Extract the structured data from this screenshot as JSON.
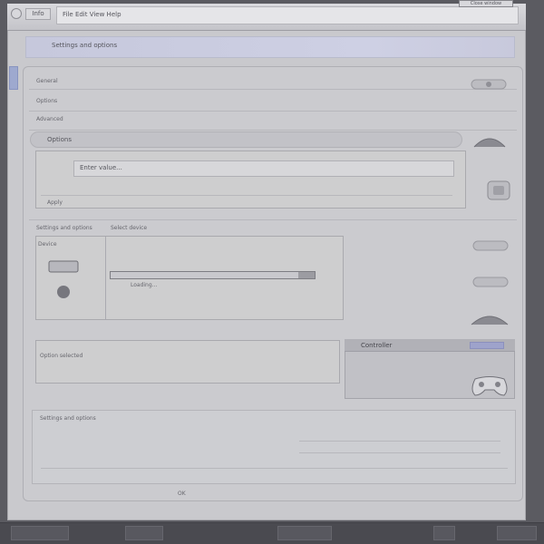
{
  "window": {
    "tab_label": "Info",
    "address": "File Edit View Help",
    "top_button": "Close window"
  },
  "header": {
    "title": "Settings and options"
  },
  "sections": {
    "row1_label": "General",
    "row2_label": "Options",
    "row3_label": "Advanced",
    "pill_label": "Options",
    "field_value": "Enter value...",
    "bottom_label": "Apply",
    "section2_title": "Settings and options",
    "section2_sub": "Select device",
    "left_card_label": "Device",
    "progress_label": "Loading...",
    "progress_value": 0.92,
    "right_card_label": "Controller",
    "bottom_field": "Option selected",
    "bottom_table_title": "Settings and options",
    "footer_text": "OK"
  },
  "colors": {
    "accent": "#9ea3cb",
    "panel": "#cbcbcf"
  },
  "icons": [
    "gear-icon",
    "globe-icon",
    "gamepad-icon",
    "speaker-icon"
  ]
}
